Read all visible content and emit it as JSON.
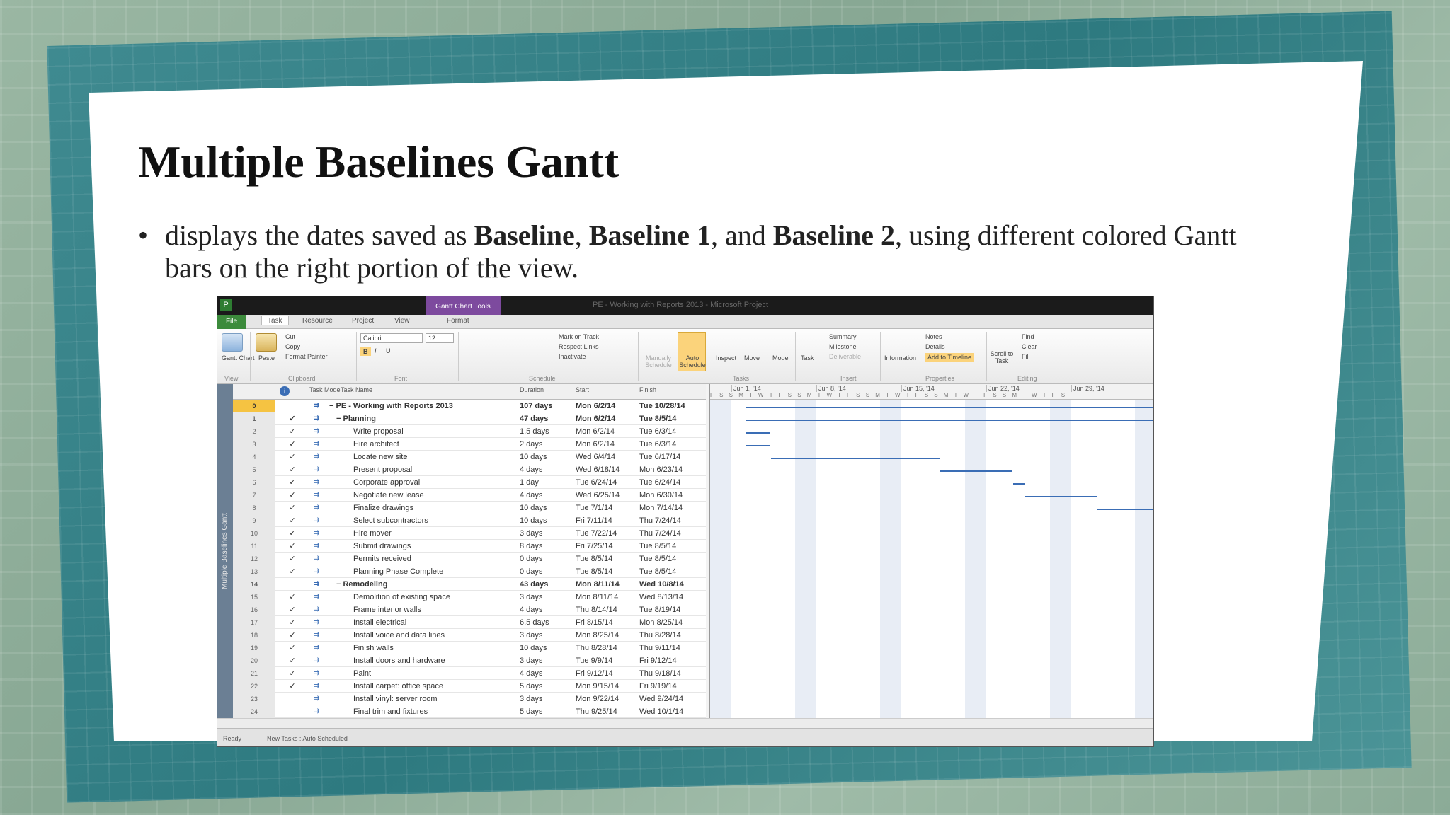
{
  "slide": {
    "title": "Multiple Baselines Gantt",
    "bullet_pre": "displays the dates saved as ",
    "b1": "Baseline",
    "sep1": ", ",
    "b2": "Baseline 1",
    "sep2": ", and ",
    "b3": "Baseline 2",
    "bullet_post": ", using different colored Gantt bars on the right portion of the view."
  },
  "app": {
    "context_tab": "Gantt Chart Tools",
    "window_title": "PE - Working with Reports 2013 - Microsoft Project",
    "tabs": [
      "File",
      "Task",
      "Resource",
      "Project",
      "View",
      "Format"
    ],
    "active_tab": "Task",
    "ribbon": {
      "gantt_chart": "Gantt Chart",
      "paste": "Paste",
      "cut": "Cut",
      "copy": "Copy",
      "format_painter": "Format Painter",
      "font_name": "Calibri",
      "font_size": "12",
      "mark_on_track": "Mark on Track",
      "respect_links": "Respect Links",
      "inactivate": "Inactivate",
      "manually_schedule": "Manually Schedule",
      "auto_schedule": "Auto Schedule",
      "inspect": "Inspect",
      "move": "Move",
      "mode": "Mode",
      "task": "Task",
      "summary": "Summary",
      "milestone": "Milestone",
      "deliverable": "Deliverable",
      "information": "Information",
      "notes": "Notes",
      "details": "Details",
      "add_to_timeline": "Add to Timeline",
      "scroll_to_task": "Scroll to Task",
      "find": "Find",
      "clear": "Clear",
      "fill": "Fill",
      "groups": [
        "View",
        "Clipboard",
        "Font",
        "Schedule",
        "Tasks",
        "Insert",
        "Properties",
        "Editing"
      ]
    },
    "side_label": "Multiple Baselines Gantt",
    "columns": {
      "mode": "Task Mode",
      "name": "Task Name",
      "duration": "Duration",
      "start": "Start",
      "finish": "Finish"
    },
    "rows": [
      {
        "id": "0",
        "check": "",
        "name": "− PE - Working with Reports 2013",
        "duration": "107 days",
        "start": "Mon 6/2/14",
        "finish": "Tue 10/28/14",
        "summary": true,
        "indent": 0,
        "selected": true
      },
      {
        "id": "1",
        "check": "✓",
        "name": "− Planning",
        "duration": "47 days",
        "start": "Mon 6/2/14",
        "finish": "Tue 8/5/14",
        "summary": true,
        "indent": 1
      },
      {
        "id": "2",
        "check": "✓",
        "name": "Write proposal",
        "duration": "1.5 days",
        "start": "Mon 6/2/14",
        "finish": "Tue 6/3/14",
        "indent": 2
      },
      {
        "id": "3",
        "check": "✓",
        "name": "Hire architect",
        "duration": "2 days",
        "start": "Mon 6/2/14",
        "finish": "Tue 6/3/14",
        "indent": 2
      },
      {
        "id": "4",
        "check": "✓",
        "name": "Locate new site",
        "duration": "10 days",
        "start": "Wed 6/4/14",
        "finish": "Tue 6/17/14",
        "indent": 2
      },
      {
        "id": "5",
        "check": "✓",
        "name": "Present proposal",
        "duration": "4 days",
        "start": "Wed 6/18/14",
        "finish": "Mon 6/23/14",
        "indent": 2
      },
      {
        "id": "6",
        "check": "✓",
        "name": "Corporate approval",
        "duration": "1 day",
        "start": "Tue 6/24/14",
        "finish": "Tue 6/24/14",
        "indent": 2
      },
      {
        "id": "7",
        "check": "✓",
        "name": "Negotiate new lease",
        "duration": "4 days",
        "start": "Wed 6/25/14",
        "finish": "Mon 6/30/14",
        "indent": 2
      },
      {
        "id": "8",
        "check": "✓",
        "name": "Finalize drawings",
        "duration": "10 days",
        "start": "Tue 7/1/14",
        "finish": "Mon 7/14/14",
        "indent": 2
      },
      {
        "id": "9",
        "check": "✓",
        "name": "Select subcontractors",
        "duration": "10 days",
        "start": "Fri 7/11/14",
        "finish": "Thu 7/24/14",
        "indent": 2
      },
      {
        "id": "10",
        "check": "✓",
        "name": "Hire mover",
        "duration": "3 days",
        "start": "Tue 7/22/14",
        "finish": "Thu 7/24/14",
        "indent": 2
      },
      {
        "id": "11",
        "check": "✓",
        "name": "Submit drawings",
        "duration": "8 days",
        "start": "Fri 7/25/14",
        "finish": "Tue 8/5/14",
        "indent": 2
      },
      {
        "id": "12",
        "check": "✓",
        "name": "Permits received",
        "duration": "0 days",
        "start": "Tue 8/5/14",
        "finish": "Tue 8/5/14",
        "indent": 2
      },
      {
        "id": "13",
        "check": "✓",
        "name": "Planning Phase Complete",
        "duration": "0 days",
        "start": "Tue 8/5/14",
        "finish": "Tue 8/5/14",
        "indent": 2
      },
      {
        "id": "14",
        "check": "",
        "name": "− Remodeling",
        "duration": "43 days",
        "start": "Mon 8/11/14",
        "finish": "Wed 10/8/14",
        "summary": true,
        "indent": 1
      },
      {
        "id": "15",
        "check": "✓",
        "name": "Demolition of existing space",
        "duration": "3 days",
        "start": "Mon 8/11/14",
        "finish": "Wed 8/13/14",
        "indent": 2
      },
      {
        "id": "16",
        "check": "✓",
        "name": "Frame interior walls",
        "duration": "4 days",
        "start": "Thu 8/14/14",
        "finish": "Tue 8/19/14",
        "indent": 2
      },
      {
        "id": "17",
        "check": "✓",
        "name": "Install electrical",
        "duration": "6.5 days",
        "start": "Fri 8/15/14",
        "finish": "Mon 8/25/14",
        "indent": 2
      },
      {
        "id": "18",
        "check": "✓",
        "name": "Install voice and data lines",
        "duration": "3 days",
        "start": "Mon 8/25/14",
        "finish": "Thu 8/28/14",
        "indent": 2
      },
      {
        "id": "19",
        "check": "✓",
        "name": "Finish walls",
        "duration": "10 days",
        "start": "Thu 8/28/14",
        "finish": "Thu 9/11/14",
        "indent": 2
      },
      {
        "id": "20",
        "check": "✓",
        "name": "Install doors and hardware",
        "duration": "3 days",
        "start": "Tue 9/9/14",
        "finish": "Fri 9/12/14",
        "indent": 2
      },
      {
        "id": "21",
        "check": "✓",
        "name": "Paint",
        "duration": "4 days",
        "start": "Fri 9/12/14",
        "finish": "Thu 9/18/14",
        "indent": 2
      },
      {
        "id": "22",
        "check": "✓",
        "name": "Install carpet: office space",
        "duration": "5 days",
        "start": "Mon 9/15/14",
        "finish": "Fri 9/19/14",
        "indent": 2
      },
      {
        "id": "23",
        "check": "",
        "name": "Install vinyl: server room",
        "duration": "3 days",
        "start": "Mon 9/22/14",
        "finish": "Wed 9/24/14",
        "indent": 2
      },
      {
        "id": "24",
        "check": "",
        "name": "Final trim and fixtures",
        "duration": "5 days",
        "start": "Thu 9/25/14",
        "finish": "Wed 10/1/14",
        "indent": 2
      }
    ],
    "timescale_weeks": [
      "Jun 1, '14",
      "Jun 8, '14",
      "Jun 15, '14",
      "Jun 22, '14",
      "Jun 29, '14"
    ],
    "day_letters": "F S S M T W T F S S M T W T F S S M T W T F S S M T W T F S S M T W T F S",
    "status_ready": "Ready",
    "status_new_tasks": "New Tasks : Auto Scheduled",
    "colors": {
      "accent_green": "#3c8b3c",
      "context_purple": "#7d4a9e",
      "bar_blue": "#3a6db5"
    }
  }
}
